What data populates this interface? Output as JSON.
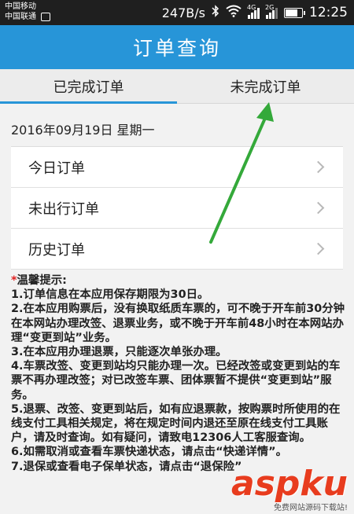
{
  "status_bar": {
    "carrier1": "中国移动",
    "carrier2": "中国联通",
    "speed": "247B/s",
    "net1": "4G",
    "net2": "2G",
    "time": "12:25"
  },
  "title": "订单查询",
  "tabs": [
    "已完成订单",
    "未完成订单"
  ],
  "active_tab": "已完成订单",
  "date_text": "2016年09月19日 星期一",
  "list_items": [
    "今日订单",
    "未出行订单",
    "历史订单"
  ],
  "tips": {
    "asterisk": "*",
    "heading": "温馨提示:",
    "lines": [
      "1.订单信息在本应用保存期限为30日。",
      "2.在本应用购票后，没有换取纸质车票的，可不晚于开车前30分钟在本网站办理改签、退票业务，或不晚于开车前48小时在本网站办理“变更到站”业务。",
      "3.在本应用办理退票，只能逐次单张办理。",
      "4.车票改签、变更到站均只能办理一次。已经改签或变更到站的车票不再办理改签；对已改签车票、团体票暂不提供“变更到站”服务。",
      "5.退票、改签、变更到站后，如有应退票款，按购票时所使用的在线支付工具相关规定，将在规定时间内退还至原在线支付工具账户，请及时查询。如有疑问，请致电12306人工客服查询。",
      "6.如需取消或查看车票快递状态，请点击“快递详情”。",
      "7.退保或查看电子保单状态，请点击“退保险”"
    ]
  },
  "watermark": {
    "main": "aspku",
    "sub": "免费网站源码下载站!"
  },
  "colors": {
    "accent": "#2795d8",
    "annotation_arrow": "#34a93a",
    "watermark": "#e83c1e"
  }
}
